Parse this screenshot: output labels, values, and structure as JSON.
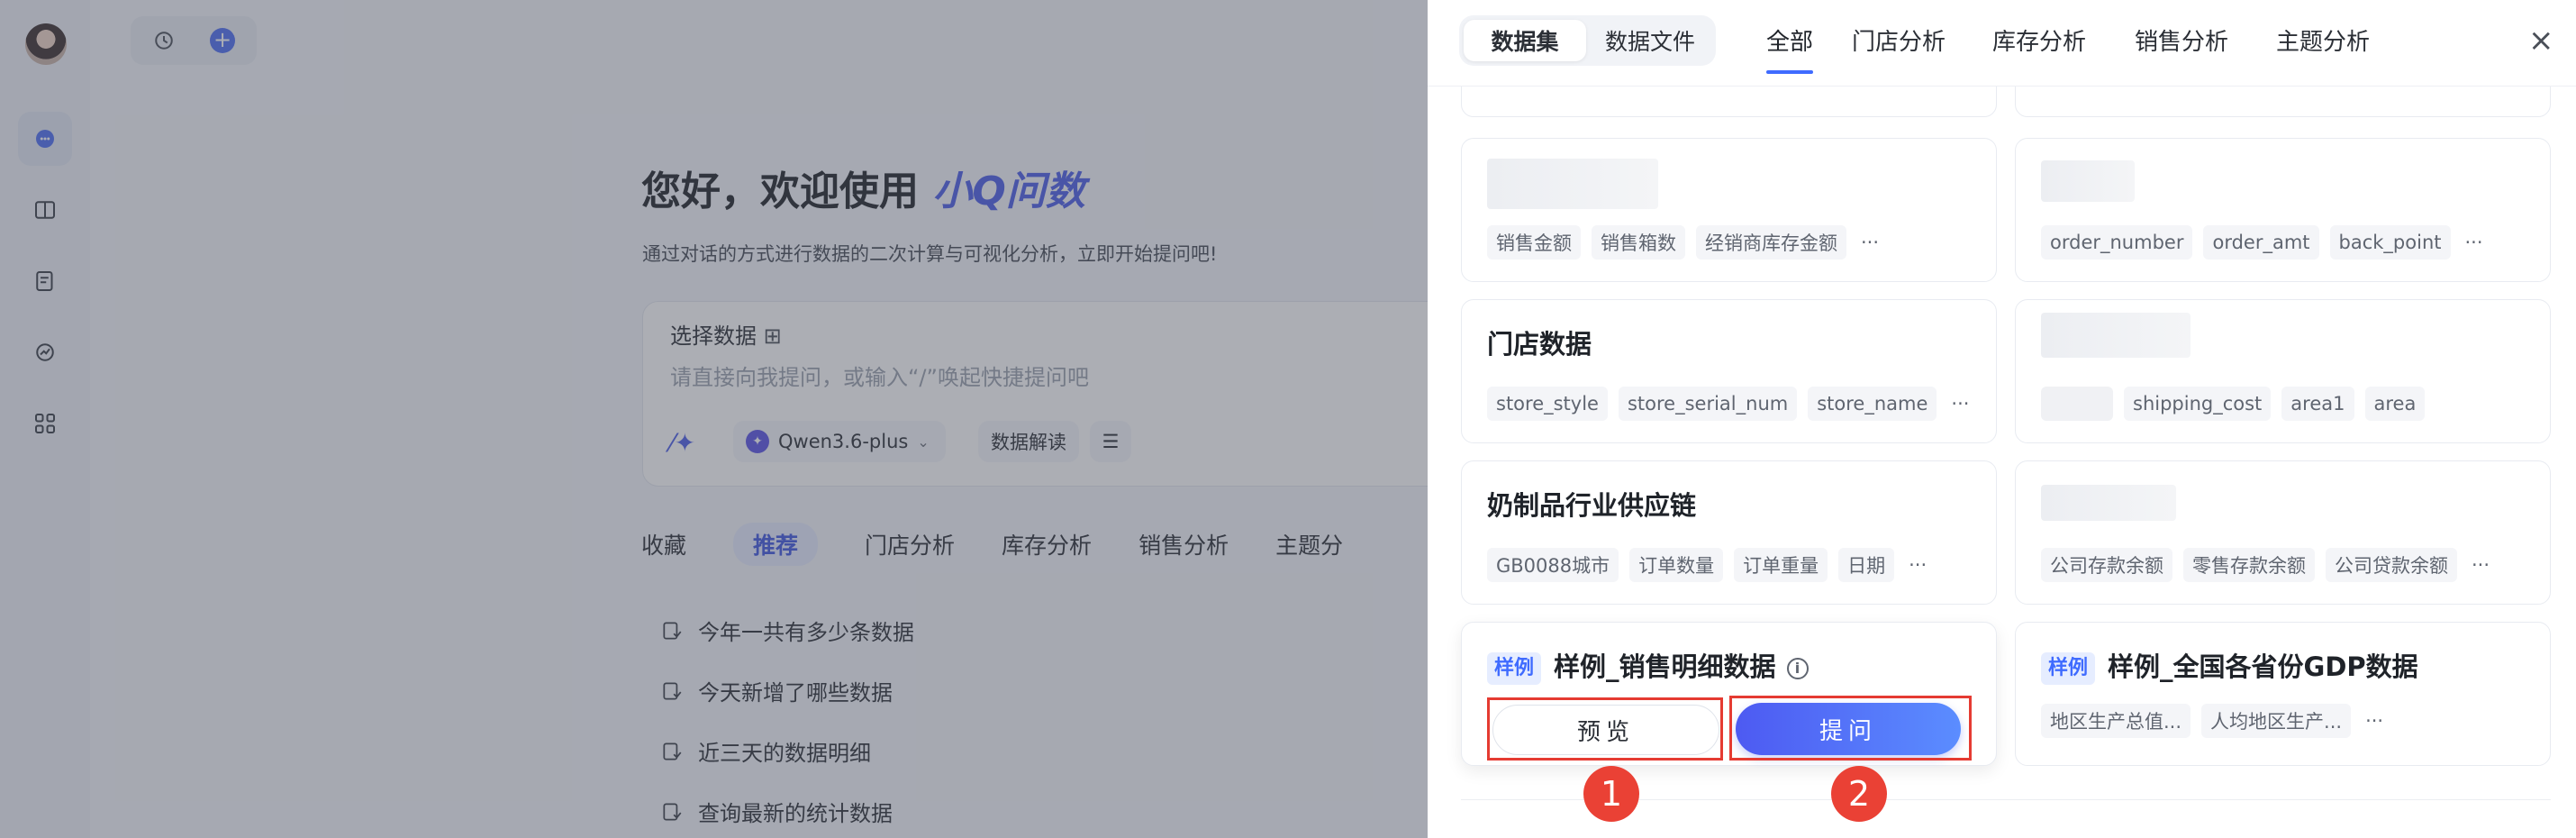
{
  "app": {
    "hero_prefix": "您好，欢迎使用",
    "hero_brand": "小Q问数",
    "subtitle": "通过对话的方式进行数据的二次计算与可视化分析，立即开始提问吧!",
    "composer": {
      "select_data_label": "选择数据",
      "placeholder": "请直接向我提问，或输入“/”唤起快捷提问吧",
      "model_name": "Qwen3.6-plus",
      "interpret_label": "数据解读"
    },
    "question_tabs": [
      "收藏",
      "推荐",
      "门店分析",
      "库存分析",
      "销售分析",
      "主题分"
    ],
    "questions": [
      "今年一共有多少条数据",
      "今天新增了哪些数据",
      "近三天的数据明细",
      "查询最新的统计数据"
    ]
  },
  "drawer": {
    "segments": [
      "数据集",
      "数据文件"
    ],
    "tabs": [
      "全部",
      "门店分析",
      "库存分析",
      "销售分析",
      "主题分析"
    ],
    "close_label": "×",
    "cards": [
      {
        "title": "",
        "tags": [
          "销售金额",
          "销售箱数",
          "经销商库存金额"
        ],
        "more": "···"
      },
      {
        "title": "",
        "tags": [
          "order_number",
          "order_amt",
          "back_point"
        ],
        "more": "···"
      },
      {
        "title": "门店数据",
        "tags": [
          "store_style",
          "store_serial_num",
          "store_name"
        ],
        "more": "···"
      },
      {
        "title": "",
        "tags": [
          "shipping_cost",
          "area1",
          "area"
        ],
        "more": ""
      },
      {
        "title": "奶制品行业供应链",
        "tags": [
          "GB0088城市",
          "订单数量",
          "订单重量",
          "日期"
        ],
        "more": "···"
      },
      {
        "title": "",
        "tags": [
          "公司存款余额",
          "零售存款余额",
          "公司贷款余额"
        ],
        "more": "···"
      },
      {
        "badge": "样例",
        "title": "样例_销售明细数据",
        "info": "i"
      },
      {
        "badge": "样例",
        "title": "样例_全国各省份GDP数据",
        "tags": [
          "地区生产总值...",
          "人均地区生产..."
        ],
        "more": "···"
      }
    ],
    "preview_label": "预览",
    "ask_label": "提问",
    "markers": [
      "1",
      "2"
    ],
    "highlight_color": "#e53b32",
    "accent_color": "#3f6bff"
  }
}
